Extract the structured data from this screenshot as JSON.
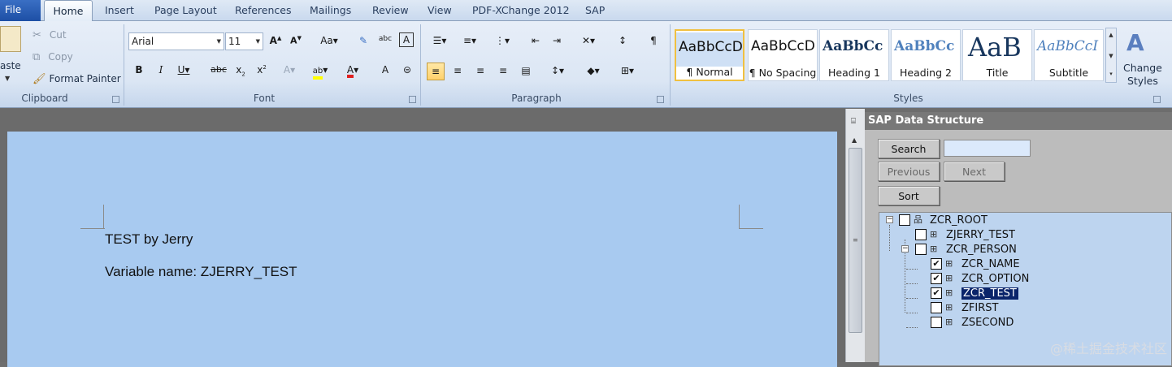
{
  "tabs": {
    "file": "File",
    "home": "Home",
    "insert": "Insert",
    "page_layout": "Page Layout",
    "references": "References",
    "mailings": "Mailings",
    "review": "Review",
    "view": "View",
    "pdfxchange": "PDF-XChange 2012",
    "sap": "SAP"
  },
  "clipboard": {
    "paste": "aste",
    "cut": "Cut",
    "copy": "Copy",
    "format_painter": "Format Painter",
    "label": "Clipboard"
  },
  "font": {
    "family": "Arial",
    "size": "11",
    "label": "Font"
  },
  "paragraph": {
    "label": "Paragraph"
  },
  "styles": {
    "label": "Styles",
    "items": [
      {
        "preview": "AaBbCcD",
        "name": "¶ Normal"
      },
      {
        "preview": "AaBbCcD",
        "name": "¶ No Spacing"
      },
      {
        "preview": "AaBbCc",
        "name": "Heading 1"
      },
      {
        "preview": "AaBbCc",
        "name": "Heading 2"
      },
      {
        "preview": "AaB",
        "name": "Title"
      },
      {
        "preview": "AaBbCcI",
        "name": "Subtitle"
      }
    ],
    "change_styles_line1": "Change",
    "change_styles_line2": "Styles"
  },
  "document": {
    "line1": "TEST by Jerry",
    "line2": "Variable name: ZJERRY_TEST"
  },
  "sap_pane": {
    "title": "SAP Data Structure",
    "search": "Search",
    "search_value": "",
    "previous": "Previous",
    "next": "Next",
    "sort": "Sort",
    "tree": [
      {
        "label": "ZCR_ROOT",
        "checked": false
      },
      {
        "label": "ZJERRY_TEST",
        "checked": false
      },
      {
        "label": "ZCR_PERSON",
        "checked": false
      },
      {
        "label": "ZCR_NAME",
        "checked": true
      },
      {
        "label": "ZCR_OPTION",
        "checked": true
      },
      {
        "label": "ZCR_TEST",
        "checked": true,
        "selected": true
      },
      {
        "label": "ZFIRST",
        "checked": false
      },
      {
        "label": "ZSECOND",
        "checked": false
      }
    ]
  },
  "watermark": "@稀土掘金技术社区"
}
